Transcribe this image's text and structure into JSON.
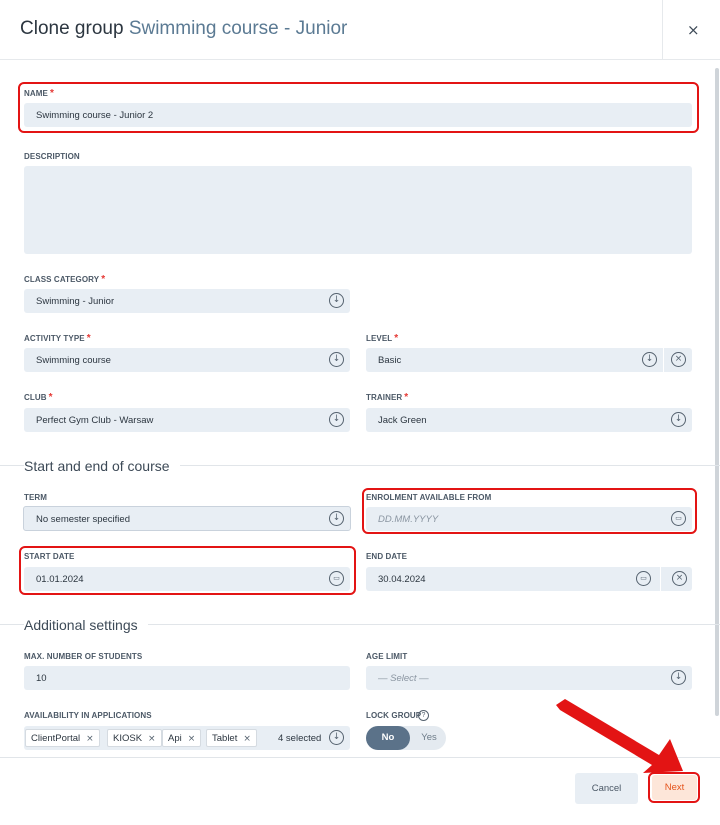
{
  "header": {
    "title_prefix": "Clone group",
    "group_name": "Swimming course - Junior",
    "close_glyph": "×"
  },
  "form": {
    "name": {
      "label": "NAME",
      "value": "Swimming course - Junior 2"
    },
    "description": {
      "label": "DESCRIPTION",
      "value": ""
    },
    "class_category": {
      "label": "CLASS CATEGORY",
      "value": "Swimming - Junior"
    },
    "activity_type": {
      "label": "ACTIVITY TYPE",
      "value": "Swimming course"
    },
    "level": {
      "label": "LEVEL",
      "value": "Basic"
    },
    "club": {
      "label": "CLUB",
      "value": "Perfect Gym Club - Warsaw"
    },
    "trainer": {
      "label": "TRAINER",
      "value": "Jack Green"
    }
  },
  "section_course": {
    "title": "Start and end of course",
    "term": {
      "label": "TERM",
      "value": "No semester specified"
    },
    "enrolment": {
      "label": "ENROLMENT AVAILABLE FROM",
      "placeholder": "DD.MM.YYYY"
    },
    "start_date": {
      "label": "START DATE",
      "value": "01.01.2024"
    },
    "end_date": {
      "label": "END DATE",
      "value": "30.04.2024"
    }
  },
  "section_additional": {
    "title": "Additional settings",
    "max_students": {
      "label": "MAX. NUMBER OF STUDENTS",
      "value": "10"
    },
    "age_limit": {
      "label": "AGE LIMIT",
      "placeholder": "— Select —"
    },
    "availability": {
      "label": "AVAILABILITY IN APPLICATIONS",
      "chips": [
        "ClientPortal",
        "KIOSK",
        "Api",
        "Tablet"
      ],
      "count_text": "4 selected"
    },
    "lock_group": {
      "label": "LOCK GROUP",
      "help_glyph": "?",
      "on_label": "No",
      "off_label": "Yes",
      "selected": "No"
    }
  },
  "footer": {
    "cancel_label": "Cancel",
    "next_label": "Next"
  },
  "glyphs": {
    "required": "*",
    "chevron": "↓",
    "calendar": "▭",
    "clear": "×",
    "chip_remove": "×"
  },
  "colors": {
    "accent": "#5b7289",
    "highlight": "#e31414",
    "next_text": "#e5541c",
    "field_bg": "#e8eef4"
  }
}
